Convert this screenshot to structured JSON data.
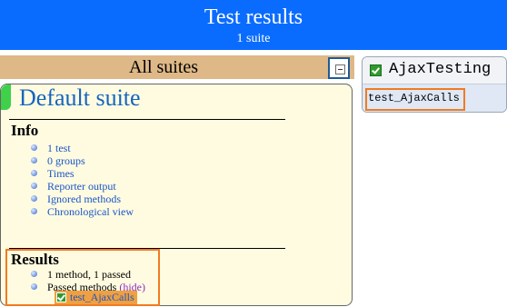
{
  "header": {
    "title": "Test results",
    "subtitle": "1 suite"
  },
  "suites_header": {
    "label": "All suites"
  },
  "suite": {
    "name": "Default suite",
    "info_title": "Info",
    "info_items": [
      "1 test",
      "0 groups",
      "Times",
      "Reporter output",
      "Ignored methods",
      "Chronological view"
    ],
    "results_title": "Results",
    "results_summary": "1 method, 1 passed",
    "passed_methods_label": "Passed methods",
    "hide_link": "(hide)",
    "passed_method": "test_AjaxCalls"
  },
  "class_panel": {
    "class_name": "AjaxTesting",
    "method": "test_AjaxCalls"
  },
  "colors": {
    "banner": "#0a6cff",
    "suites_header": "#deb887",
    "suite_panel": "#fffbe0",
    "highlight": "#f07b22",
    "pass": "#2e9b2e"
  }
}
